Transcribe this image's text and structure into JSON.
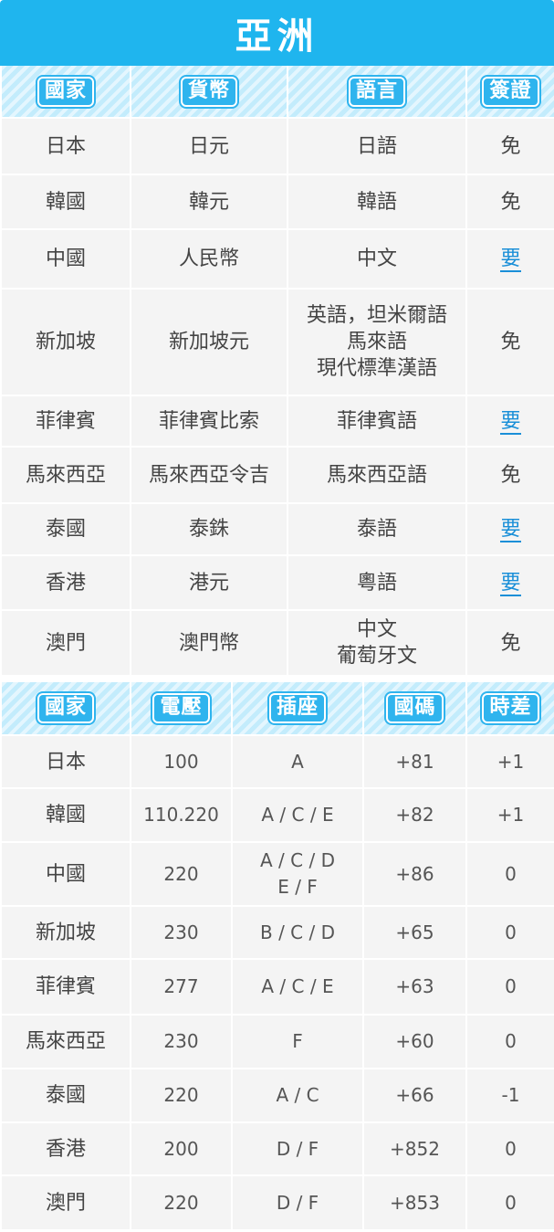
{
  "title": "亞洲",
  "table1": {
    "headers": [
      "國家",
      "貨幣",
      "語言",
      "簽證"
    ],
    "rows": [
      {
        "country": "日本",
        "currency": "日元",
        "language": [
          "日語"
        ],
        "visa": "免"
      },
      {
        "country": "韓國",
        "currency": "韓元",
        "language": [
          "韓語"
        ],
        "visa": "免"
      },
      {
        "country": "中國",
        "currency": "人民幣",
        "language": [
          "中文"
        ],
        "visa": "要"
      },
      {
        "country": "新加坡",
        "currency": "新加坡元",
        "language": [
          "英語，坦米爾語",
          "馬來語",
          "現代標準漢語"
        ],
        "visa": "免"
      },
      {
        "country": "菲律賓",
        "currency": "菲律賓比索",
        "language": [
          "菲律賓語"
        ],
        "visa": "要"
      },
      {
        "country": "馬來西亞",
        "currency": "馬來西亞令吉",
        "language": [
          "馬來西亞語"
        ],
        "visa": "免"
      },
      {
        "country": "泰國",
        "currency": "泰銖",
        "language": [
          "泰語"
        ],
        "visa": "要"
      },
      {
        "country": "香港",
        "currency": "港元",
        "language": [
          "粵語"
        ],
        "visa": "要"
      },
      {
        "country": "澳門",
        "currency": "澳門幣",
        "language": [
          "中文",
          "葡萄牙文"
        ],
        "visa": "免"
      }
    ]
  },
  "table2": {
    "headers": [
      "國家",
      "電壓",
      "插座",
      "國碼",
      "時差"
    ],
    "rows": [
      {
        "country": "日本",
        "voltage": "100",
        "plug": [
          "A"
        ],
        "code": "+81",
        "timediff": "+1"
      },
      {
        "country": "韓國",
        "voltage": "110.220",
        "plug": [
          "A / C / E"
        ],
        "code": "+82",
        "timediff": "+1"
      },
      {
        "country": "中國",
        "voltage": "220",
        "plug": [
          "A / C / D",
          "E / F"
        ],
        "code": "+86",
        "timediff": "0"
      },
      {
        "country": "新加坡",
        "voltage": "230",
        "plug": [
          "B / C / D"
        ],
        "code": "+65",
        "timediff": "0"
      },
      {
        "country": "菲律賓",
        "voltage": "277",
        "plug": [
          "A / C / E"
        ],
        "code": "+63",
        "timediff": "0"
      },
      {
        "country": "馬來西亞",
        "voltage": "230",
        "plug": [
          "F"
        ],
        "code": "+60",
        "timediff": "0"
      },
      {
        "country": "泰國",
        "voltage": "220",
        "plug": [
          "A / C"
        ],
        "code": "+66",
        "timediff": "-1"
      },
      {
        "country": "香港",
        "voltage": "200",
        "plug": [
          "D / F"
        ],
        "code": "+852",
        "timediff": "0"
      },
      {
        "country": "澳門",
        "voltage": "220",
        "plug": [
          "D / F"
        ],
        "code": "+853",
        "timediff": "0"
      }
    ]
  },
  "colors": {
    "banner": "#1fb5ee",
    "header_stripe": "#c3ecfc",
    "cell_bg": "#f4f4f4",
    "visa_required": "#1a8fd8"
  }
}
